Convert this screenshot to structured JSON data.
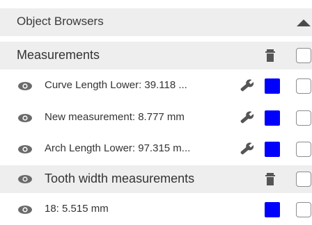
{
  "panel": {
    "title": "Object Browsers",
    "caret_icon": "caret-up-icon"
  },
  "groups": [
    {
      "label": "Measurements",
      "items": [
        {
          "label": "Curve Length Lower: 39.118 ...",
          "color": "#0000ff",
          "has_settings": true
        },
        {
          "label": "New measurement: 8.777 mm",
          "color": "#0000ff",
          "has_settings": true
        },
        {
          "label": "Arch Length Lower: 97.315 m...",
          "color": "#0000ff",
          "has_settings": true
        }
      ]
    },
    {
      "label": "Tooth width measurements",
      "items": [
        {
          "label": "18: 5.515 mm",
          "color": "#0000ff",
          "has_settings": false
        }
      ]
    }
  ],
  "colors": {
    "header_bg": "#eeeeee",
    "swatch": "#0000ff",
    "icon": "#6b6b6b"
  }
}
